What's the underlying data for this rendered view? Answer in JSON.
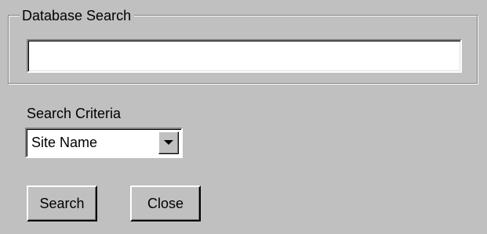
{
  "database_search": {
    "group_label": "Database Search",
    "query_value": ""
  },
  "search_criteria": {
    "label": "Search Criteria",
    "selected": "Site Name",
    "arrow_icon": "chevron-down-icon"
  },
  "buttons": {
    "search_label": "Search",
    "close_label": "Close"
  },
  "colors": {
    "face": "#c0c0c0",
    "field_background": "#ffffff",
    "shadow": "#808080",
    "highlight": "#ffffff"
  }
}
